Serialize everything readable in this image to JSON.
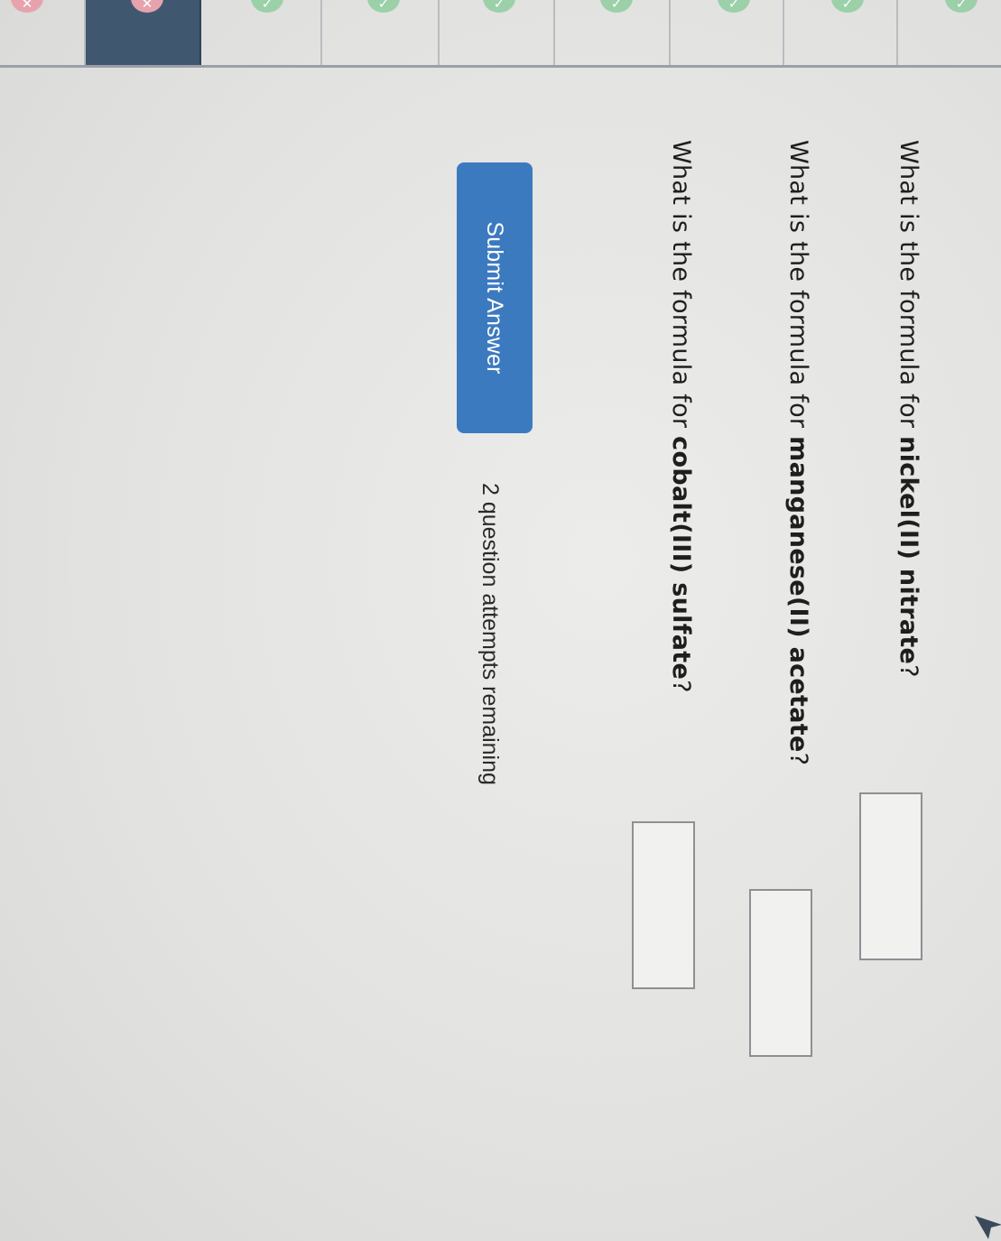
{
  "attempt_strip": {
    "cells": [
      {
        "status": "incorrect",
        "current": false
      },
      {
        "status": "incorrect",
        "current": true
      },
      {
        "status": "correct",
        "current": false
      },
      {
        "status": "correct",
        "current": false
      },
      {
        "status": "correct",
        "current": false
      },
      {
        "status": "correct",
        "current": false
      },
      {
        "status": "correct",
        "current": false
      },
      {
        "status": "correct",
        "current": false
      },
      {
        "status": "correct",
        "current": false
      }
    ],
    "icons": {
      "correct": "check-circle-icon",
      "incorrect": "x-circle-icon"
    },
    "colors": {
      "correct": "#4fae6c",
      "incorrect": "#d8485f",
      "current_cell": "#3f5870"
    }
  },
  "questions": [
    {
      "prefix": "What is the formula for ",
      "compound": "nickel(II) nitrate",
      "suffix": "?",
      "answer": ""
    },
    {
      "prefix": "What is the formula for ",
      "compound": "manganese(II) acetate",
      "suffix": "?",
      "answer": ""
    },
    {
      "prefix": "What is the formula for ",
      "compound": "cobalt(III) sulfate",
      "suffix": "?",
      "answer": ""
    }
  ],
  "submit": {
    "label": "Submit Answer",
    "color": "#3c7ac0"
  },
  "attempts_remaining": "2 question attempts remaining"
}
